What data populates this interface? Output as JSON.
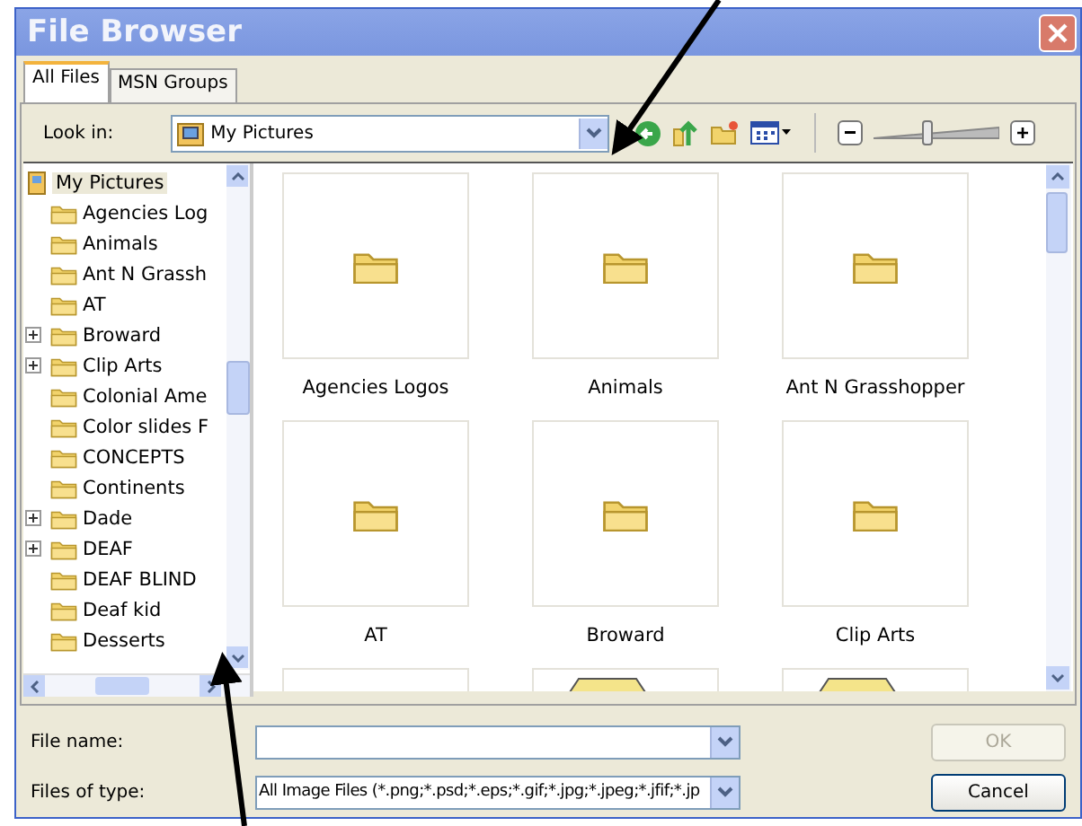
{
  "window": {
    "title": "File Browser"
  },
  "tabs": [
    {
      "label": "All Files",
      "selected": true
    },
    {
      "label": "MSN Groups",
      "selected": false
    }
  ],
  "look_in": {
    "label": "Look in:",
    "value": "My Pictures"
  },
  "zoom_slider": {
    "level": 0.42
  },
  "tree": {
    "label": "My Pictures",
    "selected": true,
    "children": [
      {
        "label": "Agencies Log",
        "expandable": false
      },
      {
        "label": "Animals",
        "expandable": false
      },
      {
        "label": "Ant N Grassh",
        "expandable": false
      },
      {
        "label": "AT",
        "expandable": false
      },
      {
        "label": "Broward",
        "expandable": true
      },
      {
        "label": "Clip Arts",
        "expandable": true
      },
      {
        "label": "Colonial Ame",
        "expandable": false
      },
      {
        "label": "Color slides F",
        "expandable": false
      },
      {
        "label": "CONCEPTS",
        "expandable": false
      },
      {
        "label": "Continents",
        "expandable": false
      },
      {
        "label": "Dade",
        "expandable": true
      },
      {
        "label": "DEAF",
        "expandable": true
      },
      {
        "label": "DEAF BLIND",
        "expandable": false
      },
      {
        "label": "Deaf kid",
        "expandable": false
      },
      {
        "label": "Desserts",
        "expandable": false
      }
    ]
  },
  "tiles": [
    {
      "kind": "folder",
      "label": "Agencies Logos"
    },
    {
      "kind": "folder",
      "label": "Animals"
    },
    {
      "kind": "folder",
      "label": "Ant N Grasshopper"
    },
    {
      "kind": "folder",
      "label": "AT"
    },
    {
      "kind": "folder",
      "label": "Broward"
    },
    {
      "kind": "folder",
      "label": "Clip Arts"
    },
    {
      "kind": "cut-off-blank"
    },
    {
      "kind": "cut-off-image"
    },
    {
      "kind": "cut-off-image"
    }
  ],
  "file_name": {
    "label": "File name:"
  },
  "file_type": {
    "label": "Files of type:",
    "value": "All Image Files (*.png;*.psd;*.eps;*.gif;*.jpg;*.jpeg;*.jfif;*.jp"
  },
  "buttons": [
    {
      "label": "OK",
      "disabled": true
    },
    {
      "label": "Cancel",
      "disabled": false
    }
  ]
}
